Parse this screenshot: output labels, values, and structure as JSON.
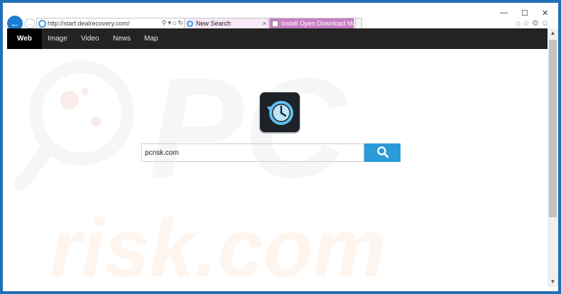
{
  "browser": {
    "address": "http://start.dealrecovery.com/",
    "tabs": [
      {
        "label": "New Search",
        "close": "×"
      },
      {
        "label": "Install Open Download Manage..."
      }
    ],
    "window_controls": {
      "minimize": "—",
      "maximize": "☐",
      "close": "✕"
    },
    "toolbar_icons": [
      "home-icon",
      "star-icon",
      "gear-icon",
      "smiley-icon"
    ]
  },
  "site_nav": {
    "items": [
      {
        "label": "Web",
        "active": true
      },
      {
        "label": "Image",
        "active": false
      },
      {
        "label": "Video",
        "active": false
      },
      {
        "label": "News",
        "active": false
      },
      {
        "label": "Map",
        "active": false
      }
    ]
  },
  "search": {
    "value": "pcrisk.com",
    "button_icon": "search-icon"
  },
  "watermark": {
    "text": "risk.com",
    "logo_text": "PC"
  },
  "colors": {
    "accent": "#2a9bd8",
    "navbar": "#232323",
    "frame": "#1e6fb8"
  }
}
